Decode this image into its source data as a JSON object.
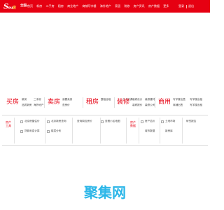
{
  "header": {
    "brand_color": "#e60012",
    "logo_text": "Soufun",
    "city": "全国",
    "nav": [
      "首页",
      "新房",
      "二手房",
      "租房",
      "商业地产",
      "商铺写字楼",
      "海外地产",
      "家居",
      "装修",
      "房产资讯",
      "房产数据",
      "更多"
    ],
    "login": "登录",
    "logout": "退出"
  },
  "services": [
    {
      "title": "买房",
      "links": [
        "新房",
        "二手房",
        "品质新房",
        "海外地产"
      ]
    },
    {
      "title": "卖房",
      "links": [
        "我要卖房",
        "查房价"
      ]
    },
    {
      "title": "租房",
      "links": [
        "整租合租",
        "个人房源"
      ]
    },
    {
      "title": "装修",
      "links": [
        "装修设计",
        "装修建材",
        "装修报价",
        "装修公司"
      ]
    },
    {
      "title": "商用",
      "links": [
        "写字楼出售",
        "写字楼出租",
        "商铺出售",
        "写字楼出租"
      ]
    }
  ],
  "panel_left": {
    "title_lines": [
      "房产",
      "工具"
    ],
    "items": [
      "北京房屋估价",
      "北京新房查询",
      "查询周边房价",
      "查看小区地图",
      "贷款利息计算",
      "楼层分布"
    ]
  },
  "panel_right": {
    "title_lines": [
      "房产",
      "数据"
    ],
    "items": [
      "房产估价",
      "土地市场",
      "研究报告",
      "城市数据",
      "新房库"
    ]
  },
  "watermark": {
    "text": "聚集网",
    "color": "#2bb6e8"
  }
}
